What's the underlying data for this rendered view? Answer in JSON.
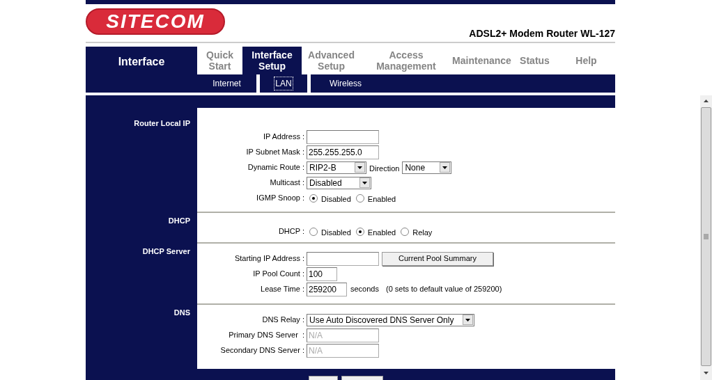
{
  "header": {
    "logo": "SITECOM",
    "model": "ADSL2+ Modem Router WL-127"
  },
  "nav": {
    "section": "Interface",
    "tabs": [
      {
        "label": "Quick Start",
        "selected": false
      },
      {
        "label": "Interface Setup",
        "selected": true
      },
      {
        "label": "Advanced Setup",
        "selected": false
      },
      {
        "label": "Access Management",
        "selected": false
      },
      {
        "label": "Maintenance",
        "selected": false
      },
      {
        "label": "Status",
        "selected": false
      },
      {
        "label": "Help",
        "selected": false
      }
    ]
  },
  "subtabs": [
    {
      "label": "Internet",
      "selected": false
    },
    {
      "label": "LAN",
      "selected": true
    },
    {
      "label": "Wireless",
      "selected": false
    }
  ],
  "sections": [
    {
      "title": "Router Local IP",
      "fields": [
        {
          "kind": "text",
          "label": "IP Address :"
        },
        {
          "kind": "text",
          "label": "IP Subnet Mask :",
          "value": "255.255.255.0"
        },
        {
          "kind": "select",
          "label": "Dynamic Route :",
          "value": "RIP2-B",
          "extra_label": "Direction",
          "extra_value": "None"
        },
        {
          "kind": "select",
          "label": "Multicast :",
          "value": "Disabled"
        },
        {
          "kind": "radio",
          "label": "IGMP Snoop :",
          "options": [
            {
              "label": "Disabled",
              "selected": true
            },
            {
              "label": "Enabled",
              "selected": false
            }
          ]
        }
      ]
    },
    {
      "title": "DHCP",
      "fields": [
        {
          "kind": "radio",
          "label": "DHCP :",
          "options": [
            {
              "label": "Disabled",
              "selected": false
            },
            {
              "label": "Enabled",
              "selected": true
            },
            {
              "label": "Relay",
              "selected": false
            }
          ]
        }
      ]
    },
    {
      "title": "DHCP Server",
      "fields": [
        {
          "kind": "text",
          "label": "Starting IP Address :",
          "button": "Current Pool Summary"
        },
        {
          "kind": "text",
          "label": "IP Pool Count :",
          "value": "100"
        },
        {
          "kind": "text",
          "label": "Lease Time :",
          "value": "259200",
          "suffix": "seconds",
          "note": "(0 sets to default value of 259200)"
        }
      ]
    },
    {
      "title": "DNS",
      "fields": [
        {
          "kind": "select",
          "label": "DNS Relay :",
          "value": "Use Auto Discovered DNS Server Only"
        },
        {
          "kind": "text",
          "label": "Primary DNS Server  :",
          "value": "N/A",
          "disabled": true
        },
        {
          "kind": "text",
          "label": "Secondary DNS Server :",
          "value": "N/A",
          "disabled": true
        }
      ]
    }
  ]
}
